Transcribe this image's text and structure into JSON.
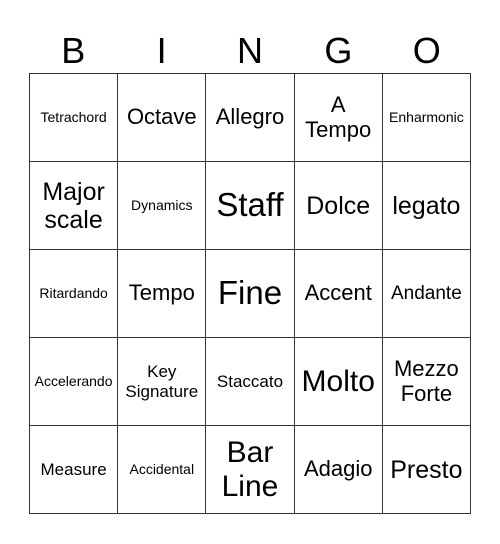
{
  "header": {
    "letters": [
      "B",
      "I",
      "N",
      "G",
      "O"
    ]
  },
  "board": {
    "rows": [
      [
        "Tetrachord",
        "Octave",
        "Allegro",
        "A Tempo",
        "Enharmonic"
      ],
      [
        "Major scale",
        "Dynamics",
        "Staff",
        "Dolce",
        "legato"
      ],
      [
        "Ritardando",
        "Tempo",
        "Fine",
        "Accent",
        "Andante"
      ],
      [
        "Accelerando",
        "Key Signature",
        "Staccato",
        "Molto",
        "Mezzo Forte"
      ],
      [
        "Measure",
        "Accidental",
        "Bar Line",
        "Adagio",
        "Presto"
      ]
    ]
  }
}
